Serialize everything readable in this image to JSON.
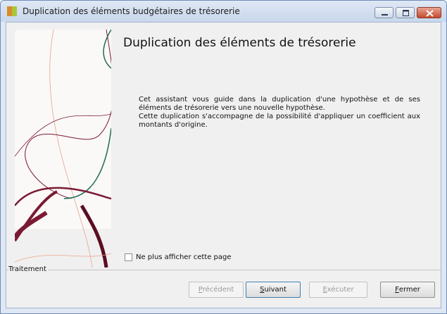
{
  "window": {
    "title": "Duplication des éléments budgétaires de trésorerie",
    "controls": {
      "minimize": "minimize-icon",
      "maximize": "maximize-icon",
      "close": "close-icon"
    }
  },
  "wizard": {
    "heading": "Duplication des éléments de trésorerie",
    "intro_line1": "Cet assistant vous guide dans la duplication d'une hypothèse et de ses éléments de trésorerie vers une nouvelle hypothèse.",
    "intro_line2": "Cette duplication s'accompagne de la possibilité d'appliquer un coefficient aux montants d'origine.",
    "dont_show_label": "Ne plus afficher cette page",
    "dont_show_checked": false,
    "group_label": "Traitement"
  },
  "buttons": {
    "previous": {
      "first": "P",
      "rest": "récédent",
      "enabled": false
    },
    "next": {
      "first": "S",
      "rest": "uivant",
      "enabled": true
    },
    "execute": {
      "first": "E",
      "rest": "xécuter",
      "enabled": false
    },
    "close": {
      "first": "F",
      "rest": "ermer",
      "enabled": true
    }
  },
  "colors": {
    "accent_wine": "#7a1a32",
    "accent_green": "#1e6e52",
    "titlebar": "#c8d7ec"
  }
}
